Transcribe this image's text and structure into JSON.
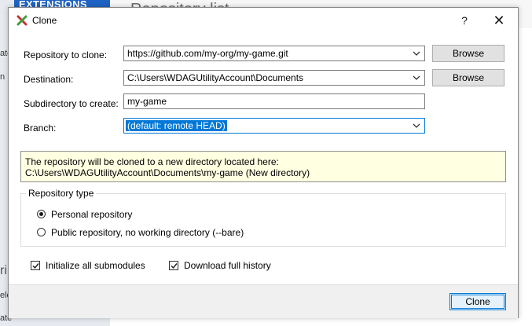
{
  "background": {
    "logo_text": "EXTENSIONS",
    "heading_fragment": "Repository list",
    "sidebar_fragments": [
      "ate",
      "n",
      "ri",
      "elc",
      "ate"
    ]
  },
  "dialog": {
    "title": "Clone",
    "help_label": "?",
    "close_label": "✕"
  },
  "form": {
    "repo_label": "Repository to clone:",
    "repo_value": "https://github.com/my-org/my-game.git",
    "destination_label": "Destination:",
    "destination_value": "C:\\Users\\WDAGUtilityAccount\\Documents",
    "subdir_label": "Subdirectory to create:",
    "subdir_value": "my-game",
    "branch_label": "Branch:",
    "branch_value": "(default: remote HEAD)",
    "browse_label": "Browse"
  },
  "info": {
    "line1": "The repository will be cloned to a new directory located here:",
    "line2": "C:\\Users\\WDAGUtilityAccount\\Documents\\my-game (New directory)"
  },
  "repo_type": {
    "legend": "Repository type",
    "personal_label": "Personal repository",
    "public_label": "Public repository, no working directory  (--bare)",
    "selected": "personal"
  },
  "options": {
    "init_submodules_label": "Initialize all submodules",
    "download_history_label": "Download full history",
    "init_submodules_checked": true,
    "download_history_checked": true
  },
  "footer": {
    "clone_label": "Clone"
  },
  "colors": {
    "accent": "#0078d7",
    "info_bg": "#ffffe1",
    "logo_bg": "#1e63c4"
  }
}
